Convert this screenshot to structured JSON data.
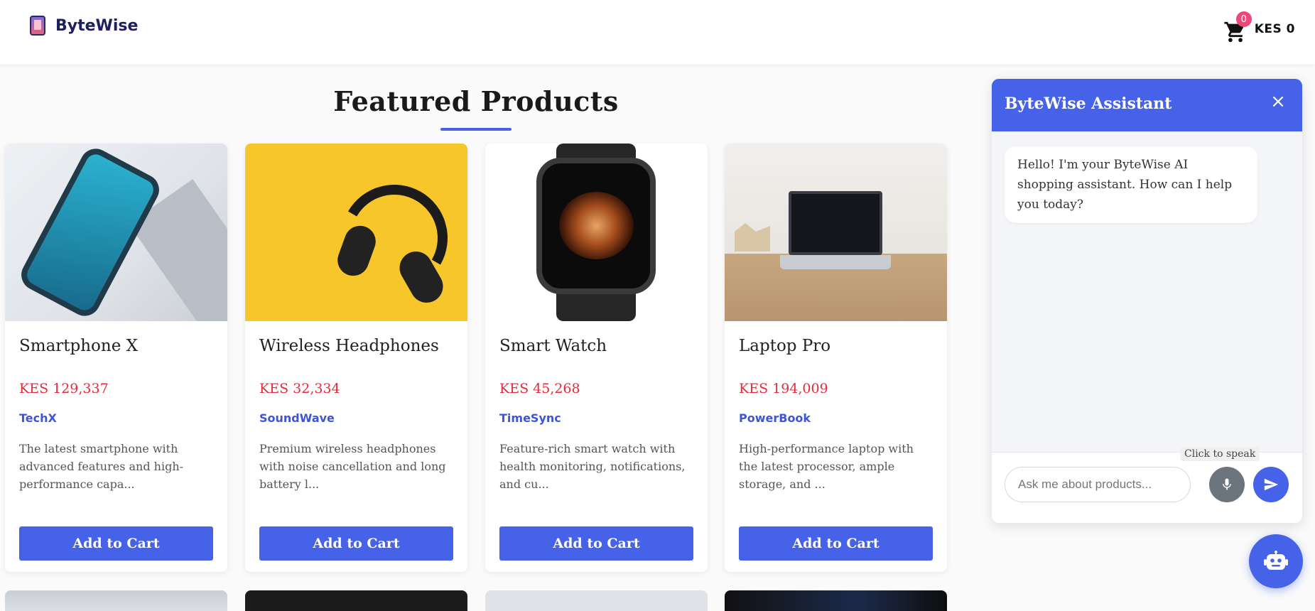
{
  "header": {
    "brand": "ByteWise",
    "cart_count": "0",
    "cart_total": "KES 0"
  },
  "main": {
    "title": "Featured Products",
    "add_to_cart_label": "Add to Cart",
    "products": [
      {
        "name": "Smartphone X",
        "price": "KES 129,337",
        "brand": "TechX",
        "description": "The latest smartphone with advanced features and high-performance capa..."
      },
      {
        "name": "Wireless Headphones",
        "price": "KES 32,334",
        "brand": "SoundWave",
        "description": "Premium wireless headphones with noise cancellation and long battery l..."
      },
      {
        "name": "Smart Watch",
        "price": "KES 45,268",
        "brand": "TimeSync",
        "description": "Feature-rich smart watch with health monitoring, notifications, and cu..."
      },
      {
        "name": "Laptop Pro",
        "price": "KES 194,009",
        "brand": "PowerBook",
        "description": "High-performance laptop with the latest processor, ample storage, and ..."
      }
    ]
  },
  "chat": {
    "title": "ByteWise Assistant",
    "close_icon": "×",
    "greeting": "Hello! I'm your ByteWise AI shopping assistant. How can I help you today?",
    "input_placeholder": "Ask me about products...",
    "speak_tooltip": "Click to speak"
  },
  "colors": {
    "accent": "#4562e8",
    "price": "#e22b3c",
    "badge": "#f0477a"
  },
  "icons": {
    "cart": "cart-icon",
    "mic": "microphone-icon",
    "send": "send-icon",
    "close": "close-icon",
    "bot": "robot-icon"
  }
}
